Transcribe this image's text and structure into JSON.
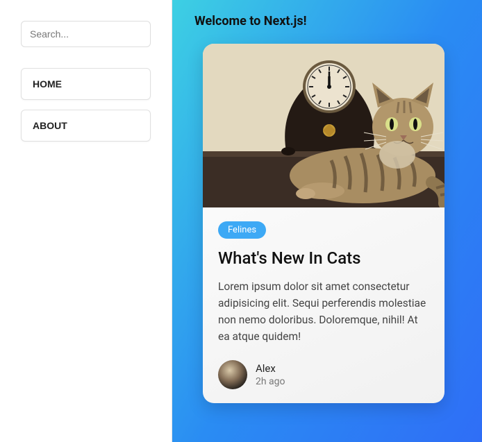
{
  "sidebar": {
    "search_placeholder": "Search...",
    "nav": [
      {
        "label": "HOME"
      },
      {
        "label": "ABOUT"
      }
    ]
  },
  "main": {
    "title": "Welcome to Next.js!",
    "card": {
      "image_name": "cat-with-clock",
      "badge": "Felines",
      "title": "What's New In Cats",
      "text": "Lorem ipsum dolor sit amet consectetur adipisicing elit. Sequi perferendis molestiae non nemo doloribus. Doloremque, nihil! At ea atque quidem!",
      "author": {
        "name": "Alex",
        "time": "2h ago"
      }
    }
  }
}
